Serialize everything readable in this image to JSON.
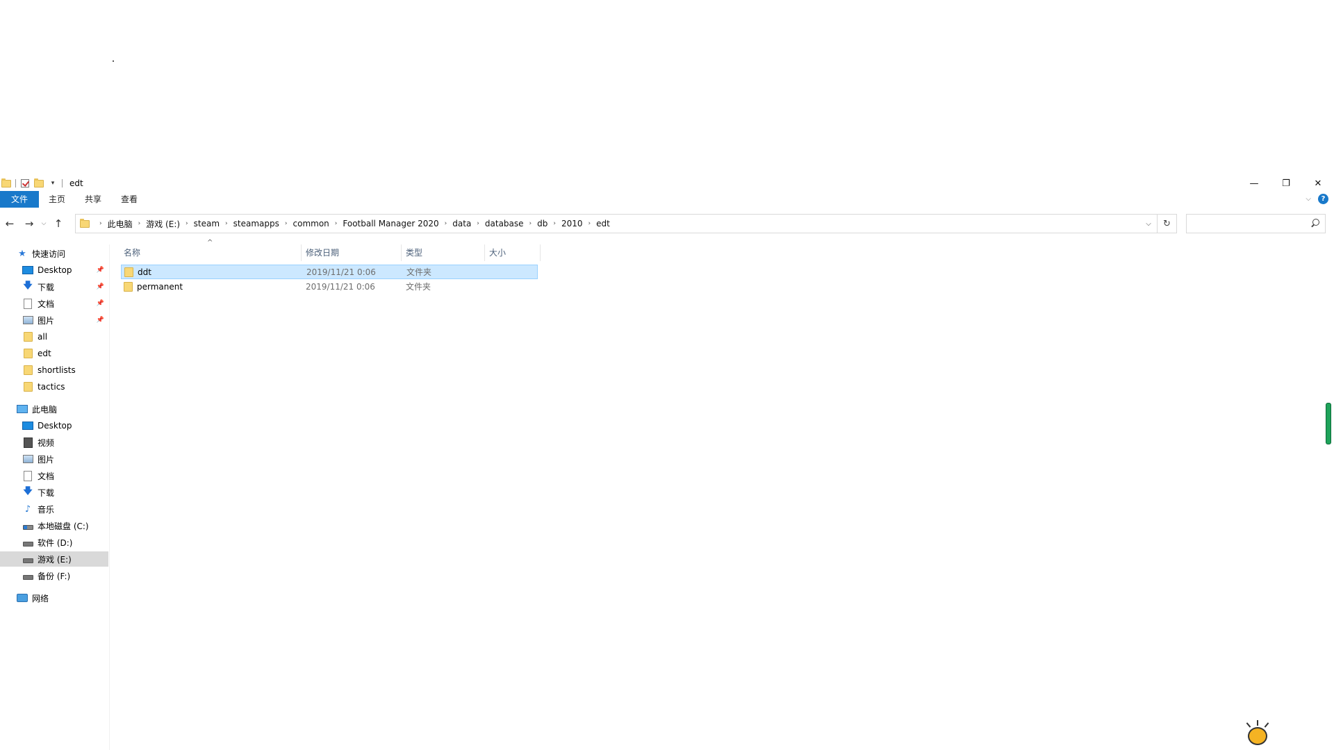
{
  "window": {
    "title": "edt",
    "controls": {
      "minimize": "—",
      "restore": "❐",
      "close": "✕"
    }
  },
  "ribbon": {
    "tabs": [
      "文件",
      "主页",
      "共享",
      "查看"
    ],
    "help": "?"
  },
  "address": {
    "crumbs": [
      "此电脑",
      "游戏 (E:)",
      "steam",
      "steamapps",
      "common",
      "Football Manager 2020",
      "data",
      "database",
      "db",
      "2010",
      "edt"
    ]
  },
  "search": {
    "placeholder": ""
  },
  "nav_pane": {
    "quick_access": {
      "label": "快速访问",
      "items": [
        {
          "label": "Desktop",
          "icon": "desktop-icon",
          "pinned": true
        },
        {
          "label": "下载",
          "icon": "download-icon",
          "pinned": true
        },
        {
          "label": "文档",
          "icon": "document-icon",
          "pinned": true
        },
        {
          "label": "图片",
          "icon": "pictures-icon",
          "pinned": true
        },
        {
          "label": "all",
          "icon": "folder-icon",
          "pinned": false
        },
        {
          "label": "edt",
          "icon": "folder-icon",
          "pinned": false
        },
        {
          "label": "shortlists",
          "icon": "folder-icon",
          "pinned": false
        },
        {
          "label": "tactics",
          "icon": "folder-icon",
          "pinned": false
        }
      ]
    },
    "this_pc": {
      "label": "此电脑",
      "items": [
        {
          "label": "Desktop",
          "icon": "desktop-icon"
        },
        {
          "label": "视频",
          "icon": "video-icon"
        },
        {
          "label": "图片",
          "icon": "pictures-icon"
        },
        {
          "label": "文档",
          "icon": "document-icon"
        },
        {
          "label": "下载",
          "icon": "download-icon"
        },
        {
          "label": "音乐",
          "icon": "music-icon"
        },
        {
          "label": "本地磁盘 (C:)",
          "icon": "system-drive-icon"
        },
        {
          "label": "软件 (D:)",
          "icon": "drive-icon"
        },
        {
          "label": "游戏 (E:)",
          "icon": "drive-icon",
          "selected": true
        },
        {
          "label": "备份 (F:)",
          "icon": "drive-icon"
        }
      ]
    },
    "network": {
      "label": "网络"
    }
  },
  "file_list": {
    "columns": [
      "名称",
      "修改日期",
      "类型",
      "大小"
    ],
    "rows": [
      {
        "name": "ddt",
        "modified": "2019/11/21 0:06",
        "type": "文件夹",
        "size": "",
        "selected": true
      },
      {
        "name": "permanent",
        "modified": "2019/11/21 0:06",
        "type": "文件夹",
        "size": "",
        "selected": false
      }
    ]
  },
  "colors": {
    "accent": "#1979ca",
    "selection": "#cce8ff",
    "nav_selected": "#d9d9d9",
    "folder": "#f8d775"
  }
}
